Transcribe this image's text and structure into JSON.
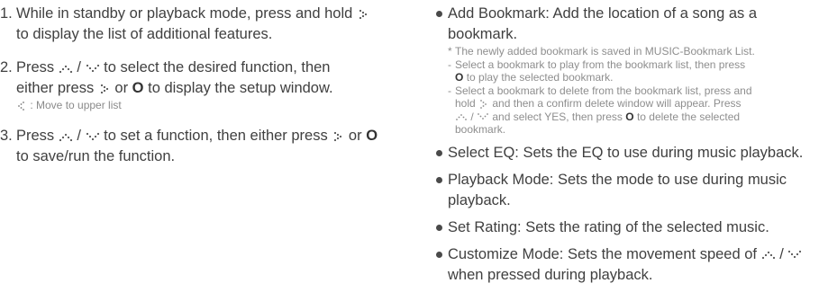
{
  "left": {
    "steps": [
      {
        "num": "1.",
        "text_a": "While in standby or playback mode, press and hold",
        "text_b": "to display the list of additional features."
      },
      {
        "num": "2.",
        "text_a": "Press",
        "text_b": "/",
        "text_c": "to select the desired function, then",
        "text_d": "either press",
        "text_e": "or",
        "text_f": "to display the setup window.",
        "note": ": Move to upper list"
      },
      {
        "num": "3.",
        "text_a": "Press",
        "text_b": "/",
        "text_c": "to set a function, then either press",
        "text_d": "or",
        "text_e": "to save/run the function."
      }
    ]
  },
  "right": {
    "bookmark": {
      "title": "Add Bookmark: Add the location of a song as a bookmark.",
      "star_note": "The newly added bookmark is saved in MUSIC-Bookmark List.",
      "play_a": "Select a bookmark to play from the bookmark list, then press",
      "play_b": "to play the selected bookmark.",
      "del_a": "Select a bookmark to delete from the bookmark list, press and",
      "del_b": "hold",
      "del_c": "and then a confirm delete window will appear. Press",
      "del_d": "/",
      "del_e": "and select YES, then press",
      "del_f": "to delete the selected",
      "del_g": "bookmark."
    },
    "items": [
      "Select EQ: Sets the EQ to use during music playback.",
      "Playback Mode: Sets the mode to use during music playback.",
      "Set Rating: Sets the rating of the selected music."
    ],
    "customize_a": "Customize Mode: Sets the movement speed of",
    "customize_b": "/",
    "customize_c": "when pressed during playback.",
    "circle_glyph": "O",
    "dash": "-",
    "star": "*"
  }
}
